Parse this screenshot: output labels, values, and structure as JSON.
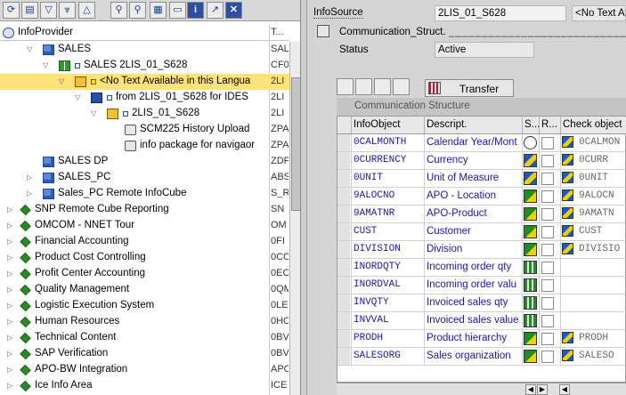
{
  "toolbar": {
    "buttons": [
      {
        "name": "refresh-icon",
        "glyph": "⟳"
      },
      {
        "name": "document-icon",
        "glyph": "▤"
      },
      {
        "name": "filter-icon",
        "glyph": "▽"
      },
      {
        "name": "filter-clear-icon",
        "glyph": "⩔"
      },
      {
        "name": "up-icon",
        "glyph": "△"
      },
      {
        "name": "binoculars-icon",
        "glyph": "⚲"
      },
      {
        "name": "binoculars-next-icon",
        "glyph": "⚲"
      },
      {
        "name": "layout-icon",
        "glyph": "▦"
      },
      {
        "name": "window-icon",
        "glyph": "▭"
      },
      {
        "name": "info-icon",
        "glyph": "i"
      },
      {
        "name": "arrow-icon",
        "glyph": "↗"
      },
      {
        "name": "close-icon",
        "glyph": "✕"
      }
    ]
  },
  "tree": {
    "header_label": "InfoProvider",
    "header_tech": "T...",
    "rows": [
      {
        "label": "SALES",
        "tech": "SAL",
        "level": 1,
        "exp": "▽",
        "icon": "cube"
      },
      {
        "label": "SALES 2LIS_01_S628",
        "tech": "CF0",
        "level": 2,
        "exp": "▽",
        "icon": "bowtie"
      },
      {
        "label": "<No Text Available in this Langua",
        "tech": "2LI",
        "level": 3,
        "exp": "▽",
        "icon": "pkg",
        "selected": true
      },
      {
        "label": "from 2LIS_01_S628 for IDES",
        "tech": "2LI",
        "level": 4,
        "exp": "▽",
        "icon": "flow"
      },
      {
        "label": "2LIS_01_S628",
        "tech": "2LI",
        "level": 5,
        "exp": "▽",
        "icon": "pkg"
      },
      {
        "label": "SCM225 History Upload",
        "tech": "ZPA",
        "level": 6,
        "exp": "",
        "icon": "sched"
      },
      {
        "label": "info package for navigaor",
        "tech": "ZPA",
        "level": 6,
        "exp": "",
        "icon": "sched"
      },
      {
        "label": "SALES DP",
        "tech": "ZDP",
        "level": 1,
        "exp": "",
        "icon": "cube"
      },
      {
        "label": "SALES_PC",
        "tech": "ABS",
        "level": 1,
        "exp": "▷",
        "icon": "cube"
      },
      {
        "label": "Sales_PC Remote InfoCube",
        "tech": "S_R",
        "level": 1,
        "exp": "▷",
        "icon": "cube"
      },
      {
        "label": "SNP Remote Cube Reporting",
        "tech": "SN",
        "level": 0,
        "exp": "▷",
        "icon": "diam"
      },
      {
        "label": "OMCOM - NNET Tour",
        "tech": "OM",
        "level": 0,
        "exp": "▷",
        "icon": "diam"
      },
      {
        "label": "Financial Accounting",
        "tech": "0FI",
        "level": 0,
        "exp": "▷",
        "icon": "diam"
      },
      {
        "label": "Product Cost Controlling",
        "tech": "0CO",
        "level": 0,
        "exp": "▷",
        "icon": "diam"
      },
      {
        "label": "Profit Center Accounting",
        "tech": "0EC",
        "level": 0,
        "exp": "▷",
        "icon": "diam"
      },
      {
        "label": "Quality Management",
        "tech": "0QM",
        "level": 0,
        "exp": "▷",
        "icon": "diam"
      },
      {
        "label": "Logistic Execution System",
        "tech": "0LE",
        "level": 0,
        "exp": "▷",
        "icon": "diam"
      },
      {
        "label": "Human Resources",
        "tech": "0HC",
        "level": 0,
        "exp": "▷",
        "icon": "diam"
      },
      {
        "label": "Technical Content",
        "tech": "0BV",
        "level": 0,
        "exp": "▷",
        "icon": "diam"
      },
      {
        "label": "SAP Verification",
        "tech": "0BV",
        "level": 0,
        "exp": "▷",
        "icon": "diam"
      },
      {
        "label": "APO-BW Integration",
        "tech": "APO",
        "level": 0,
        "exp": "▷",
        "icon": "diam"
      },
      {
        "label": "Ice Info Area",
        "tech": "ICE",
        "level": 0,
        "exp": "▷",
        "icon": "diam"
      }
    ]
  },
  "form": {
    "infosource_label": "InfoSource",
    "infosource_value": "2LIS_01_S628",
    "infosource_desc": "<No Text Avail",
    "comm_struct_label": "Communication_Struct.",
    "status_label": "Status",
    "status_value": "Active"
  },
  "actions": {
    "transfer_label": "Transfer"
  },
  "comm_struct": {
    "title": "Communication Structure",
    "headers": {
      "obj": "InfoObject",
      "desc": "Descript.",
      "s": "S...",
      "r": "R...",
      "check": "Check object"
    },
    "rows": [
      {
        "obj": "0CALMONTH",
        "desc": "Calendar Year/Mont",
        "type": "clock",
        "check": "0CALMON"
      },
      {
        "obj": "0CURRENCY",
        "desc": "Currency",
        "type": "tri",
        "check": "0CURR"
      },
      {
        "obj": "0UNIT",
        "desc": "Unit of Measure",
        "type": "tri",
        "check": "0UNIT"
      },
      {
        "obj": "9ALOCNO",
        "desc": "APO - Location",
        "type": "green",
        "check": "9ALOCN"
      },
      {
        "obj": "9AMATNR",
        "desc": "APO-Product",
        "type": "green",
        "check": "9AMATN"
      },
      {
        "obj": "CUST",
        "desc": "Customer",
        "type": "green",
        "check": "CUST"
      },
      {
        "obj": "DIVISION",
        "desc": "Division",
        "type": "green",
        "check": "DIVISIO"
      },
      {
        "obj": "INORDQTY",
        "desc": "Incoming order qty",
        "type": "grid",
        "check": ""
      },
      {
        "obj": "INORDVAL",
        "desc": "Incoming order valu",
        "type": "grid",
        "check": ""
      },
      {
        "obj": "INVQTY",
        "desc": "Invoiced sales qty",
        "type": "grid",
        "check": ""
      },
      {
        "obj": "INVVAL",
        "desc": "Invoiced sales value",
        "type": "grid",
        "check": ""
      },
      {
        "obj": "PRODH",
        "desc": "Product hierarchy",
        "type": "green",
        "check": "PRODH"
      },
      {
        "obj": "SALESORG",
        "desc": "Sales organization",
        "type": "green",
        "check": "SALESO"
      }
    ]
  }
}
